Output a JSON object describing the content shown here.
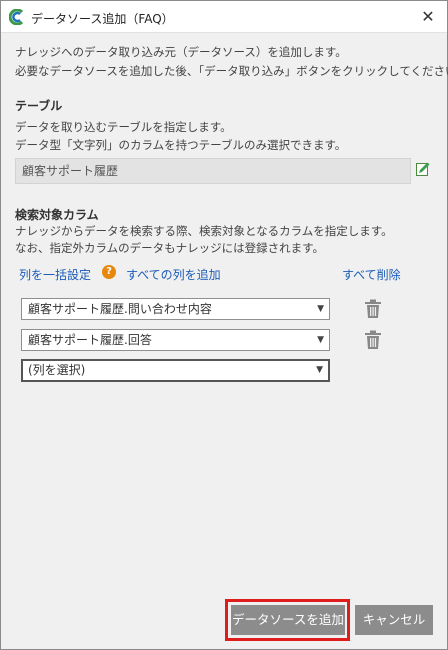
{
  "window": {
    "title": "データソース追加（FAQ）",
    "close_label": "✕"
  },
  "intro": {
    "line1": "ナレッジへのデータ取り込み元（データソース）を追加します。",
    "line2": "必要なデータソースを追加した後、「データ取り込み」ボタンをクリックしてください。"
  },
  "table_section": {
    "heading": "テーブル",
    "desc1": "データを取り込むテーブルを指定します。",
    "desc2": "データ型「文字列」のカラムを持つテーブルのみ選択できます。",
    "value": "顧客サポート履歴"
  },
  "columns_section": {
    "heading": "検索対象カラム",
    "desc1": "ナレッジからデータを検索する際、検索対象となるカラムを指定します。",
    "desc2": "なお、指定外カラムのデータもナレッジには登録されます。",
    "bulk_link": "列を一括設定",
    "help_glyph": "?",
    "add_all_link": "すべての列を追加",
    "delete_all_link": "すべて削除",
    "rows": [
      {
        "value": "顧客サポート履歴.問い合わせ内容"
      },
      {
        "value": "顧客サポート履歴.回答"
      },
      {
        "value": "(列を選択)"
      }
    ]
  },
  "footer": {
    "add_button": "データソースを追加",
    "cancel_button": "キャンセル"
  },
  "colors": {
    "accent": "#1a5bb8",
    "highlight": "#e01b1b",
    "button": "#8c8c8c",
    "help": "#e8870e"
  }
}
